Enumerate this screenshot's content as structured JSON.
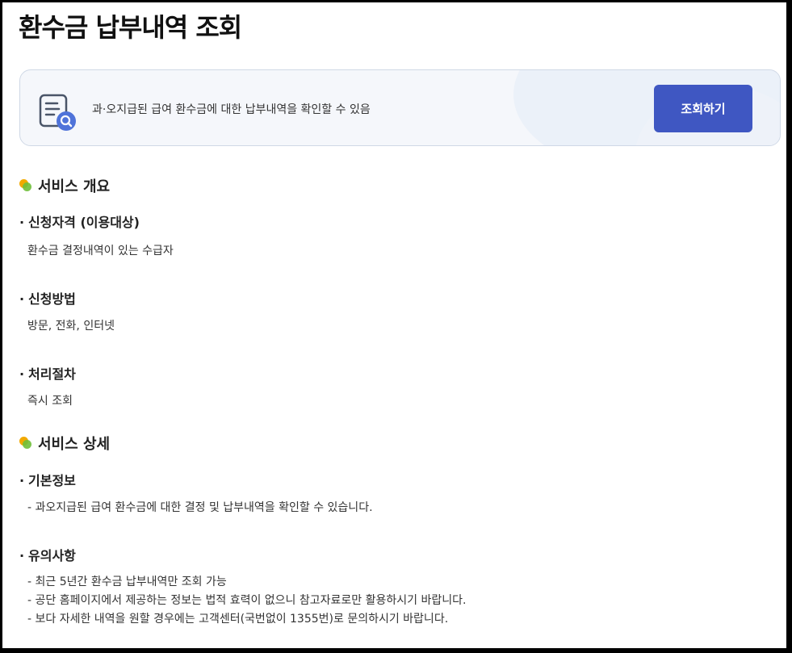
{
  "page_title": "환수금 납부내역 조회",
  "banner": {
    "description": "과·오지급된 급여 환수금에 대한 납부내역을 확인할 수 있음",
    "lookup_button": "조회하기",
    "icon": "document-search-icon"
  },
  "overview": {
    "title": "서비스 개요",
    "eligibility": {
      "heading": "신청자격 (이용대상)",
      "body": "환수금 결정내역이 있는 수급자"
    },
    "method": {
      "heading": "신청방법",
      "body": "방문, 전화, 인터넷"
    },
    "procedure": {
      "heading": "처리절차",
      "body": "즉시 조회"
    }
  },
  "detail": {
    "title": "서비스 상세",
    "basic_info": {
      "heading": "기본정보",
      "body": "- 과오지급된 급여 환수금에 대한 결정 및 납부내역을 확인할 수 있습니다."
    },
    "notes": {
      "heading": "유의사항",
      "lines": [
        "- 최근 5년간 환수금 납부내역만 조회 가능",
        "- 공단 홈페이지에서 제공하는 정보는 법적 효력이 없으니 참고자료로만 활용하시기 바랍니다.",
        "- 보다 자세한 내역을 원할 경우에는 고객센터(국번없이 1355번)로 문의하시기 바랍니다."
      ]
    }
  },
  "colors": {
    "button": "#3f57c2",
    "banner_bg": "#f5f7fb",
    "dot_orange": "#f2a900",
    "dot_green": "#6fbf3a"
  }
}
